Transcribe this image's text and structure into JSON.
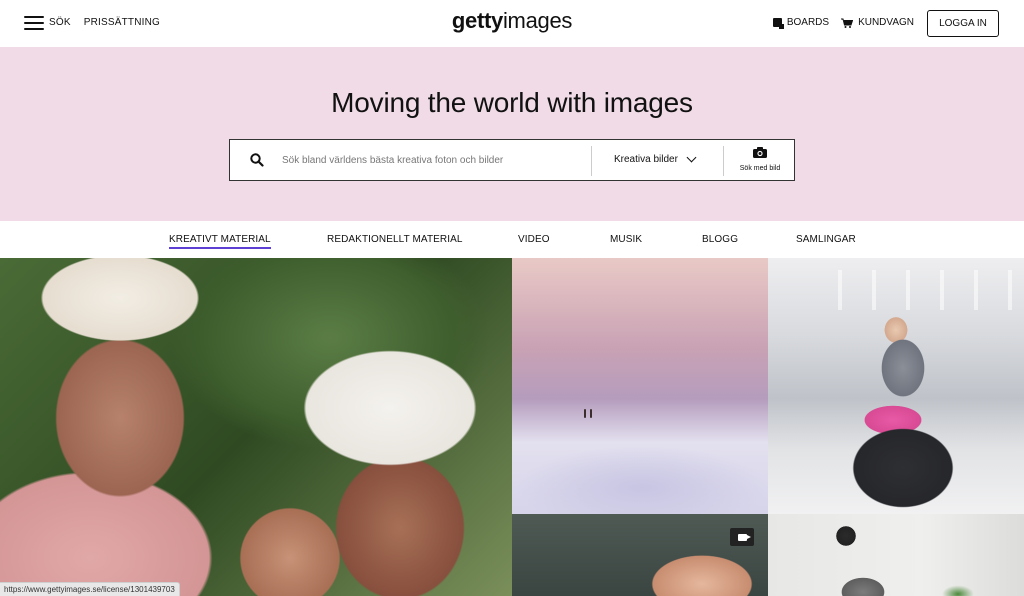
{
  "header": {
    "menu_label": "SÖK",
    "pricing_label": "PRISSÄTTNING",
    "logo_bold": "getty",
    "logo_light": "images",
    "boards_label": "BOARDS",
    "cart_label": "KUNDVAGN",
    "login_label": "LOGGA IN"
  },
  "hero": {
    "title": "Moving the world with images",
    "search_placeholder": "Sök bland världens bästa kreativa foton och bilder",
    "select_value": "Kreativa bilder",
    "image_search_label": "Sök med bild",
    "background_color": "#f0dbe6"
  },
  "tabs": [
    {
      "label": "KREATIVT MATERIAL",
      "active": true
    },
    {
      "label": "REDAKTIONELLT MATERIAL",
      "active": false
    },
    {
      "label": "VIDEO",
      "active": false
    },
    {
      "label": "MUSIK",
      "active": false
    },
    {
      "label": "BLOGG",
      "active": false
    },
    {
      "label": "SAMLINGAR",
      "active": false
    }
  ],
  "tiles": [
    {
      "subject": "two women in sun hats embracing",
      "media": "image"
    },
    {
      "subject": "two people walking on pink desert",
      "media": "image"
    },
    {
      "subject": "woman in mask with luggage at airport",
      "media": "image"
    },
    {
      "subject": "hand reaching",
      "media": "video",
      "icon": "video-camera-icon"
    },
    {
      "subject": "older person near wall clock and plant",
      "media": "image"
    }
  ],
  "status_url": "https://www.gettyimages.se/license/1301439703",
  "accent_color": "#5d3fd3"
}
